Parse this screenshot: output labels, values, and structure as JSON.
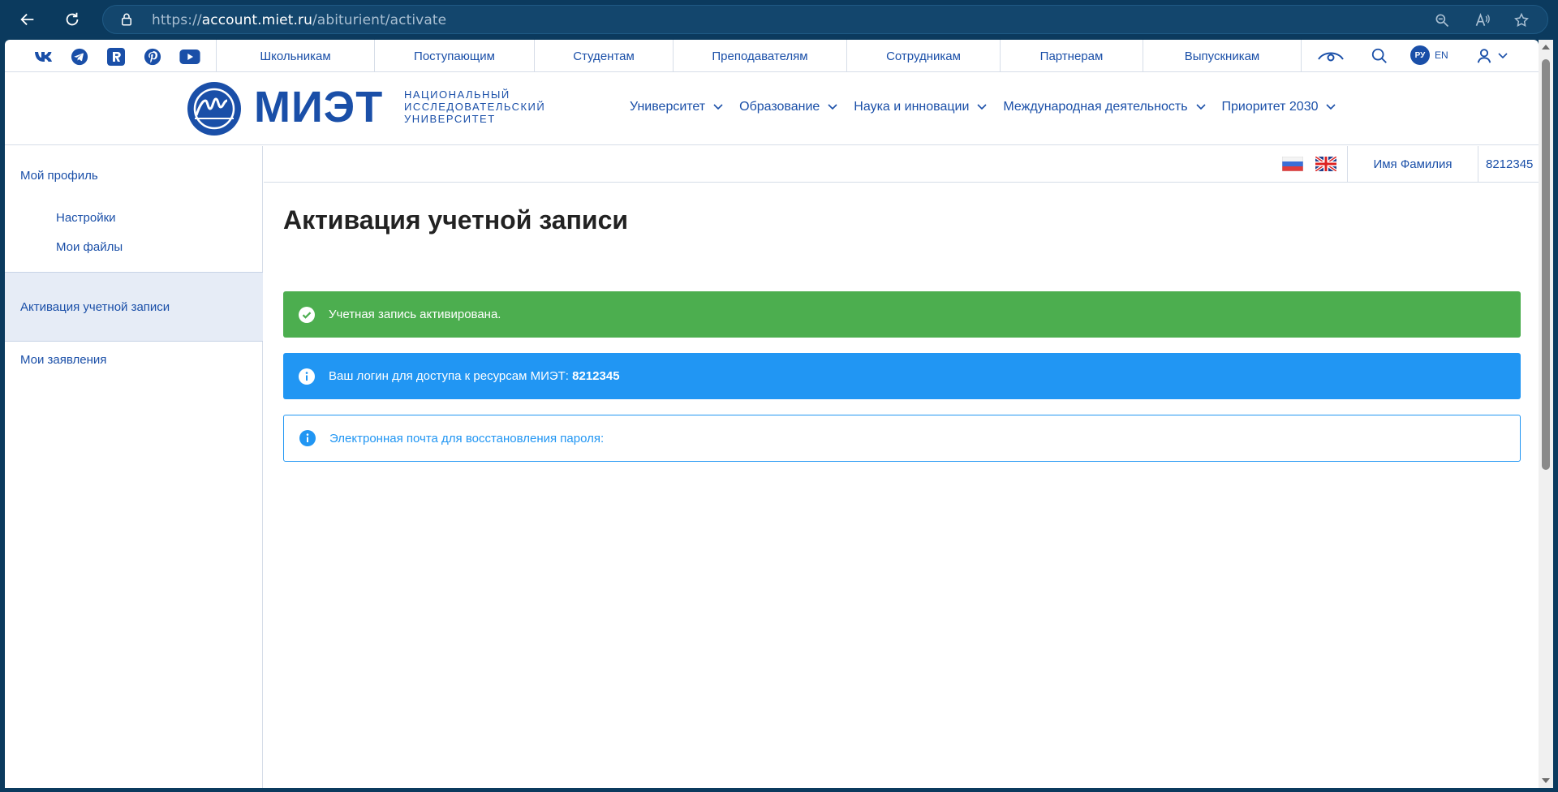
{
  "browser": {
    "url_scheme": "https://",
    "url_host": "account.miet.ru",
    "url_path": "/abiturient/activate"
  },
  "topstrip": {
    "social_icons": [
      "vk-icon",
      "telegram-icon",
      "rutube-icon",
      "pinterest-icon",
      "youtube-icon"
    ],
    "links": [
      "Школьникам",
      "Поступающим",
      "Студентам",
      "Преподавателям",
      "Сотрудникам",
      "Партнерам",
      "Выпускникам"
    ],
    "lang_active": "РУ",
    "lang_other": "EN"
  },
  "header": {
    "logo_word": "МИЭТ",
    "logo_sub": [
      "НАЦИОНАЛЬНЫЙ",
      "ИССЛЕДОВАТЕЛЬСКИЙ",
      "УНИВЕРСИТЕТ"
    ],
    "nav": [
      "Университет",
      "Образование",
      "Наука и инновации",
      "Международная деятельность",
      "Приоритет 2030"
    ]
  },
  "sidebar": {
    "profile": "Мой профиль",
    "settings": "Настройки",
    "files": "Мои файлы",
    "activation": "Активация учетной записи",
    "applications": "Мои заявления"
  },
  "userbar": {
    "name": "Имя Фамилия",
    "id": "8212345"
  },
  "main": {
    "title": "Активация учетной записи",
    "alert_success": "Учетная запись активирована.",
    "alert_login_prefix": "Ваш логин для доступа к ресурсам МИЭТ: ",
    "alert_login_value": "8212345",
    "alert_email": "Электронная почта для восстановления пароля:"
  },
  "colors": {
    "brand": "#1a4fa8",
    "success": "#4cae4f",
    "info": "#2196f3"
  }
}
